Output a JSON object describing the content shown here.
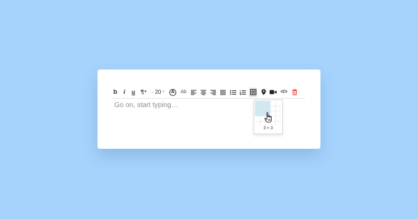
{
  "editor": {
    "placeholder": "Go on, start typing…"
  },
  "toolbar": {
    "bold": "b",
    "italic": "i",
    "underline": "u",
    "paragraph": "¶",
    "paragraph_caret": "▾",
    "font_size_minus": "–",
    "font_size": "20",
    "font_size_plus": "+",
    "color_letter": "A",
    "highlight": "Ab",
    "code": "</>",
    "icons": [
      "bold-icon",
      "italic-icon",
      "underline-icon",
      "paragraph-icon",
      "font-size-control",
      "text-color-icon",
      "highlight-icon",
      "align-left-icon",
      "align-center-icon",
      "align-right-icon",
      "justify-icon",
      "bullet-list-icon",
      "numbered-list-icon",
      "table-icon",
      "location-pin-icon",
      "video-icon",
      "code-icon",
      "trash-icon"
    ]
  },
  "table_picker": {
    "rows_selected": 3,
    "cols_selected": 3,
    "label": "3 × 3"
  },
  "colors": {
    "background": "#a6d3fc",
    "card": "#ffffff",
    "grid_highlight": "#cde9f3",
    "trash": "#e0463c"
  }
}
